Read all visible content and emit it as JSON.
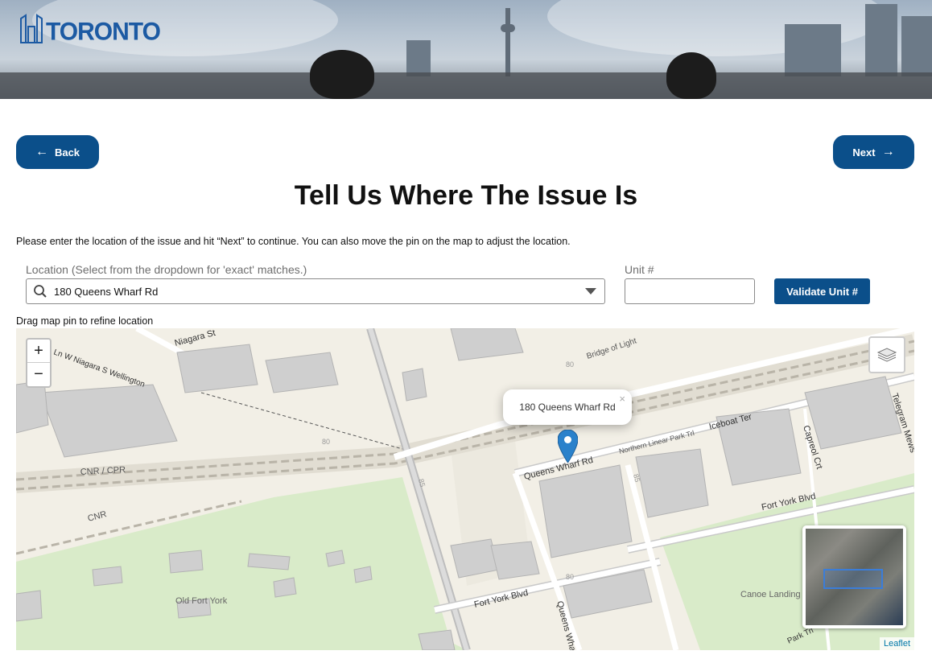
{
  "header": {
    "logo_text": "TORONTO"
  },
  "nav": {
    "back_label": "Back",
    "next_label": "Next"
  },
  "page": {
    "title": "Tell Us Where The Issue Is",
    "instructions": "Please enter the location of the issue and hit “Next” to continue. You can also move the pin on the map to adjust the location.",
    "drag_hint": "Drag map pin to refine location"
  },
  "location": {
    "label": "Location (Select from the dropdown for 'exact' matches.)",
    "value": "180 Queens Wharf Rd"
  },
  "unit": {
    "label": "Unit #",
    "value": "",
    "validate_label": "Validate Unit #"
  },
  "map": {
    "zoom_in": "+",
    "zoom_out": "−",
    "popup_text": "180 Queens Wharf Rd",
    "popup_close": "×",
    "attribution": "Leaflet",
    "labels": {
      "niagara": "Niagara St",
      "lnw": "Ln W Niagara S Wellington",
      "bridge": "Bridge of Light",
      "cnr_cpr": "CNR / CPR",
      "cnr": "CNR",
      "queens_wharf": "Queens Wharf Rd",
      "northern_linear": "Northern Linear Park Trl",
      "iceboat": "Iceboat Ter",
      "capreol": "Capreol Crt",
      "telegram": "Telegram Mews",
      "fort_york_blvd_1": "Fort York Blvd",
      "fort_york_blvd_2": "Fort York Blvd",
      "old_fort_york": "Old Fort York",
      "canoe_landing": "Canoe Landing",
      "queens_wharf_vertical": "Queens Wha",
      "park_trl": "Park Trl",
      "num_80a": "80",
      "num_80b": "80",
      "num_80c": "80",
      "num_85a": "85",
      "num_85b": "85"
    }
  },
  "colors": {
    "primary": "#0b4f8a",
    "logo": "#1c5aa3",
    "park": "#d9ebc9",
    "pin": "#2a81cb"
  }
}
